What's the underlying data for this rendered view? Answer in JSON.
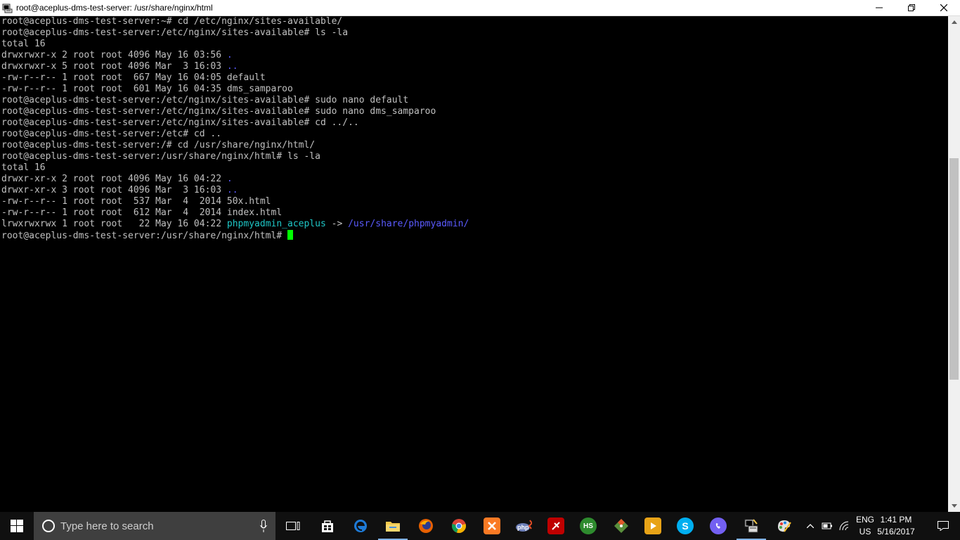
{
  "window": {
    "title": "root@aceplus-dms-test-server: /usr/share/nginx/html"
  },
  "terminal": {
    "lines": [
      [
        {
          "t": "root@aceplus-dms-test-server:~# cd /etc/nginx/sites-available/",
          "c": ""
        }
      ],
      [
        {
          "t": "root@aceplus-dms-test-server:/etc/nginx/sites-available# ls -la",
          "c": ""
        }
      ],
      [
        {
          "t": "total 16",
          "c": ""
        }
      ],
      [
        {
          "t": "drwxrwxr-x 2 root root 4096 May 16 03:56 ",
          "c": ""
        },
        {
          "t": ".",
          "c": "dir"
        }
      ],
      [
        {
          "t": "drwxrwxr-x 5 root root 4096 Mar  3 16:03 ",
          "c": ""
        },
        {
          "t": "..",
          "c": "dir"
        }
      ],
      [
        {
          "t": "-rw-r--r-- 1 root root  667 May 16 04:05 default",
          "c": ""
        }
      ],
      [
        {
          "t": "-rw-r--r-- 1 root root  601 May 16 04:35 dms_samparoo",
          "c": ""
        }
      ],
      [
        {
          "t": "root@aceplus-dms-test-server:/etc/nginx/sites-available# sudo nano default",
          "c": ""
        }
      ],
      [
        {
          "t": "root@aceplus-dms-test-server:/etc/nginx/sites-available# sudo nano dms_samparoo",
          "c": ""
        }
      ],
      [
        {
          "t": "root@aceplus-dms-test-server:/etc/nginx/sites-available# cd ../..",
          "c": ""
        }
      ],
      [
        {
          "t": "root@aceplus-dms-test-server:/etc# cd ..",
          "c": ""
        }
      ],
      [
        {
          "t": "root@aceplus-dms-test-server:/# cd /usr/share/nginx/html/",
          "c": ""
        }
      ],
      [
        {
          "t": "root@aceplus-dms-test-server:/usr/share/nginx/html# ls -la",
          "c": ""
        }
      ],
      [
        {
          "t": "total 16",
          "c": ""
        }
      ],
      [
        {
          "t": "drwxr-xr-x 2 root root 4096 May 16 04:22 ",
          "c": ""
        },
        {
          "t": ".",
          "c": "dir"
        }
      ],
      [
        {
          "t": "drwxr-xr-x 3 root root 4096 Mar  3 16:03 ",
          "c": ""
        },
        {
          "t": "..",
          "c": "dir"
        }
      ],
      [
        {
          "t": "-rw-r--r-- 1 root root  537 Mar  4  2014 50x.html",
          "c": ""
        }
      ],
      [
        {
          "t": "-rw-r--r-- 1 root root  612 Mar  4  2014 index.html",
          "c": ""
        }
      ],
      [
        {
          "t": "lrwxrwxrwx 1 root root   22 May 16 04:22 ",
          "c": ""
        },
        {
          "t": "phpmyadmin_aceplus",
          "c": "link"
        },
        {
          "t": " -> ",
          "c": ""
        },
        {
          "t": "/usr/share/phpmyadmin/",
          "c": "dir"
        }
      ],
      [
        {
          "t": "root@aceplus-dms-test-server:/usr/share/nginx/html# ",
          "c": ""
        },
        {
          "t": "",
          "c": "cursor"
        }
      ]
    ],
    "colors": {
      "text": "#c0c0c0",
      "dir": "#5b5bff",
      "link": "#1ec7c7",
      "cursor": "#00ff00"
    }
  },
  "scrollbar": {
    "thumb_position": 0.52,
    "thumb_fraction": 0.47
  },
  "taskbar": {
    "search_placeholder": "Type here to search",
    "apps": [
      {
        "name": "task-view-icon",
        "label": ""
      },
      {
        "name": "store-icon",
        "label": ""
      },
      {
        "name": "edge-icon",
        "label": ""
      },
      {
        "name": "file-explorer-icon",
        "label": ""
      },
      {
        "name": "firefox-icon",
        "label": ""
      },
      {
        "name": "chrome-icon",
        "label": ""
      },
      {
        "name": "xampp-icon",
        "label": ""
      },
      {
        "name": "php-icon",
        "label": "php"
      },
      {
        "name": "filezilla-icon",
        "label": ""
      },
      {
        "name": "heidisql-icon",
        "label": "HS"
      },
      {
        "name": "git-icon",
        "label": ""
      },
      {
        "name": "media-player-icon",
        "label": ""
      },
      {
        "name": "skype-icon",
        "label": "S"
      },
      {
        "name": "viber-icon",
        "label": ""
      },
      {
        "name": "putty-icon",
        "label": ""
      },
      {
        "name": "paint-icon",
        "label": ""
      }
    ],
    "language": [
      "ENG",
      "US"
    ],
    "time": "1:41 PM",
    "date": "5/16/2017"
  }
}
